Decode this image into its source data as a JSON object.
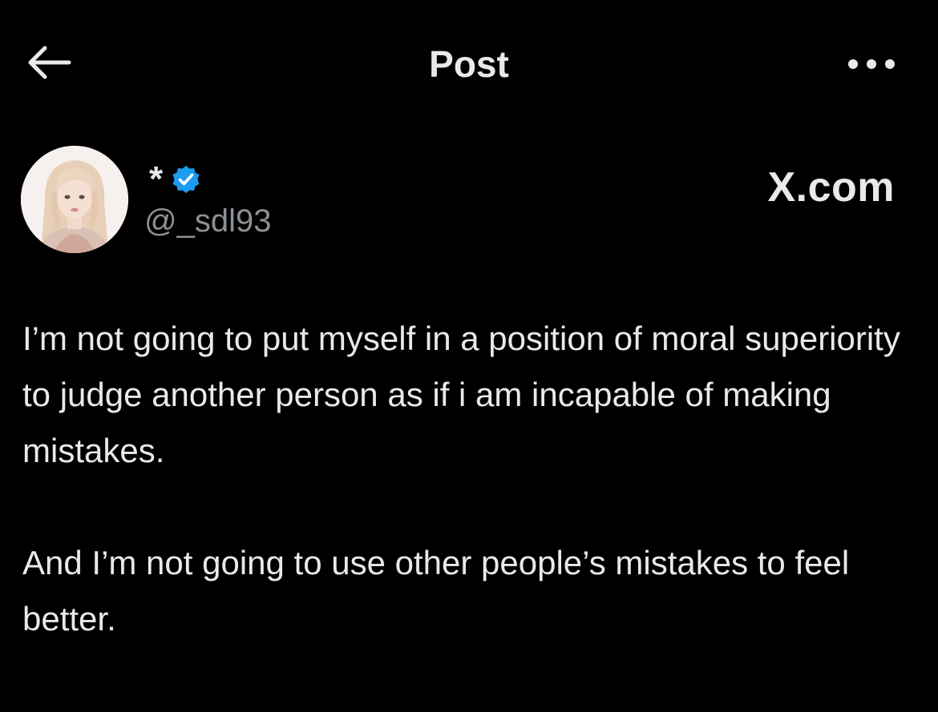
{
  "header": {
    "title": "Post",
    "back_icon": "arrow-left-icon",
    "more_icon": "more-horizontal-icon"
  },
  "author": {
    "display_name": "*",
    "handle": "@_sdl93",
    "verified": true,
    "verified_color": "#1d9bf0",
    "avatar_icon": "avatar-photo"
  },
  "source_mark": "X.com",
  "post": {
    "paragraphs": [
      "I’m not going to put myself in a position of moral superiority to judge another person as if i am incapable of making mistakes.",
      "And I’m not going to use other people’s mistakes to feel better."
    ]
  },
  "colors": {
    "background": "#000000",
    "text_primary": "#e7e9ea",
    "text_secondary": "#8b9095",
    "accent": "#1d9bf0"
  }
}
